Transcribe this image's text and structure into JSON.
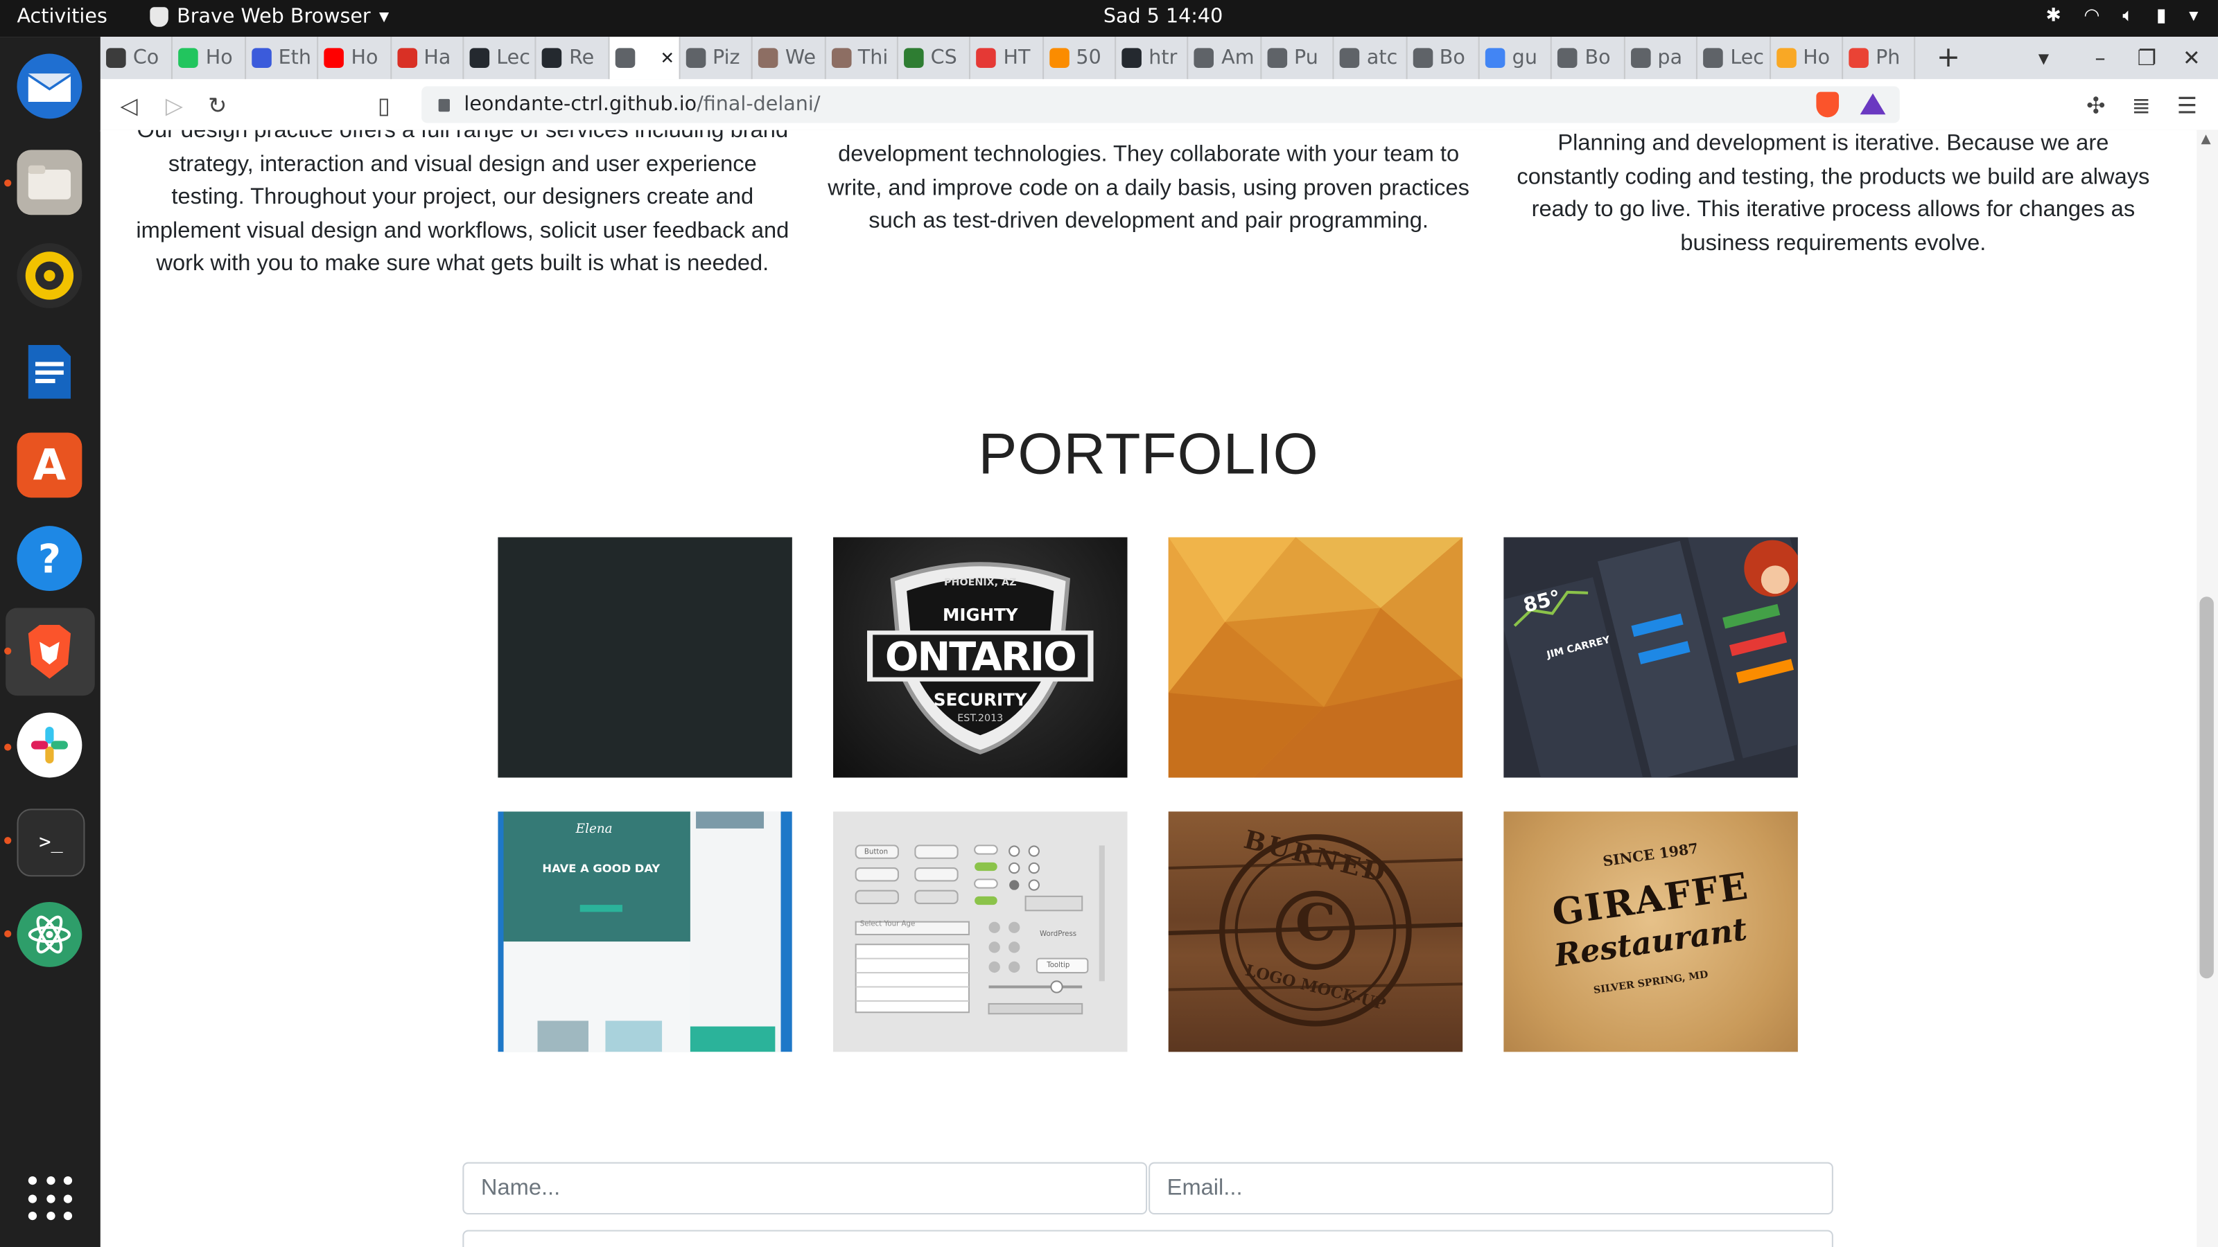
{
  "system": {
    "activities": "Activities",
    "app_name": "Brave Web Browser",
    "clock": "Sad 5  14:40"
  },
  "tabs": [
    {
      "label": "Co",
      "color": "#3c3c3c"
    },
    {
      "label": "Ho",
      "color": "#22c55e"
    },
    {
      "label": "Eth",
      "color": "#3b5bdb"
    },
    {
      "label": "Ho",
      "color": "#ff0000"
    },
    {
      "label": "Ha",
      "color": "#d93025"
    },
    {
      "label": "Lec",
      "color": "#24292f"
    },
    {
      "label": "Re",
      "color": "#24292f"
    },
    {
      "label": "",
      "color": "#5f6368",
      "active": true
    },
    {
      "label": "Piz",
      "color": "#5f6368"
    },
    {
      "label": "We",
      "color": "#8d6e63"
    },
    {
      "label": "Thi",
      "color": "#8d6e63"
    },
    {
      "label": "CS",
      "color": "#2e7d32"
    },
    {
      "label": "HT",
      "color": "#e53935"
    },
    {
      "label": "50",
      "color": "#fb8c00"
    },
    {
      "label": "htr",
      "color": "#24292f"
    },
    {
      "label": "Am",
      "color": "#5f6368"
    },
    {
      "label": "Pu",
      "color": "#5f6368"
    },
    {
      "label": "atc",
      "color": "#5f6368"
    },
    {
      "label": "Bo",
      "color": "#5f6368"
    },
    {
      "label": "gu",
      "color": "#4285f4"
    },
    {
      "label": "Bo",
      "color": "#5f6368"
    },
    {
      "label": "pa",
      "color": "#5f6368"
    },
    {
      "label": "Lec",
      "color": "#5f6368"
    },
    {
      "label": "Ho",
      "color": "#f9a825"
    },
    {
      "label": "Ph",
      "color": "#ea4335"
    }
  ],
  "browser": {
    "url_host": "leondante-ctrl.github.io",
    "url_path": "/final-delani/"
  },
  "services": {
    "col1": "Our design practice offers a full range of services including brand strategy, interaction and visual design and user experience testing. Throughout your project, our designers create and implement visual design and workflows, solicit user feedback and work with you to make sure what gets built is what is needed.",
    "col2": "development technologies. They collaborate with your team to write, and improve code on a daily basis, using proven practices such as test-driven development and pair programming.",
    "col3": "Planning and development is iterative. Because we are constantly coding and testing, the products we build are always ready to go live. This iterative process allows for changes as business requirements evolve."
  },
  "portfolio": {
    "title": "PORTFOLIO",
    "items": [
      {
        "name": "dark-square"
      },
      {
        "name": "ontario-security",
        "top": "PHOENIX, AZ",
        "mid": "MIGHTY",
        "main": "ONTARIO",
        "sub": "SECURITY",
        "est": "EST.2013"
      },
      {
        "name": "orange-polygon"
      },
      {
        "name": "dashboard-ui",
        "temp": "85°",
        "person": "JIM CARREY"
      },
      {
        "name": "good-day-site",
        "brand": "Elena",
        "heading": "HAVE A GOOD DAY"
      },
      {
        "name": "ui-kit",
        "select": "Select Your Age",
        "tag": "WordPress",
        "tooltip": "Tooltip",
        "button": "Button"
      },
      {
        "name": "burned-stamp",
        "line1": "BURNED",
        "letter": "C",
        "line2": "LOGO MOCK-UP"
      },
      {
        "name": "giraffe-restaurant",
        "since": "SINCE 1987",
        "main": "GIRAFFE",
        "script": "Restaurant",
        "place": "SILVER SPRING, MD"
      }
    ]
  },
  "contact": {
    "name_placeholder": "Name...",
    "email_placeholder": "Email..."
  }
}
